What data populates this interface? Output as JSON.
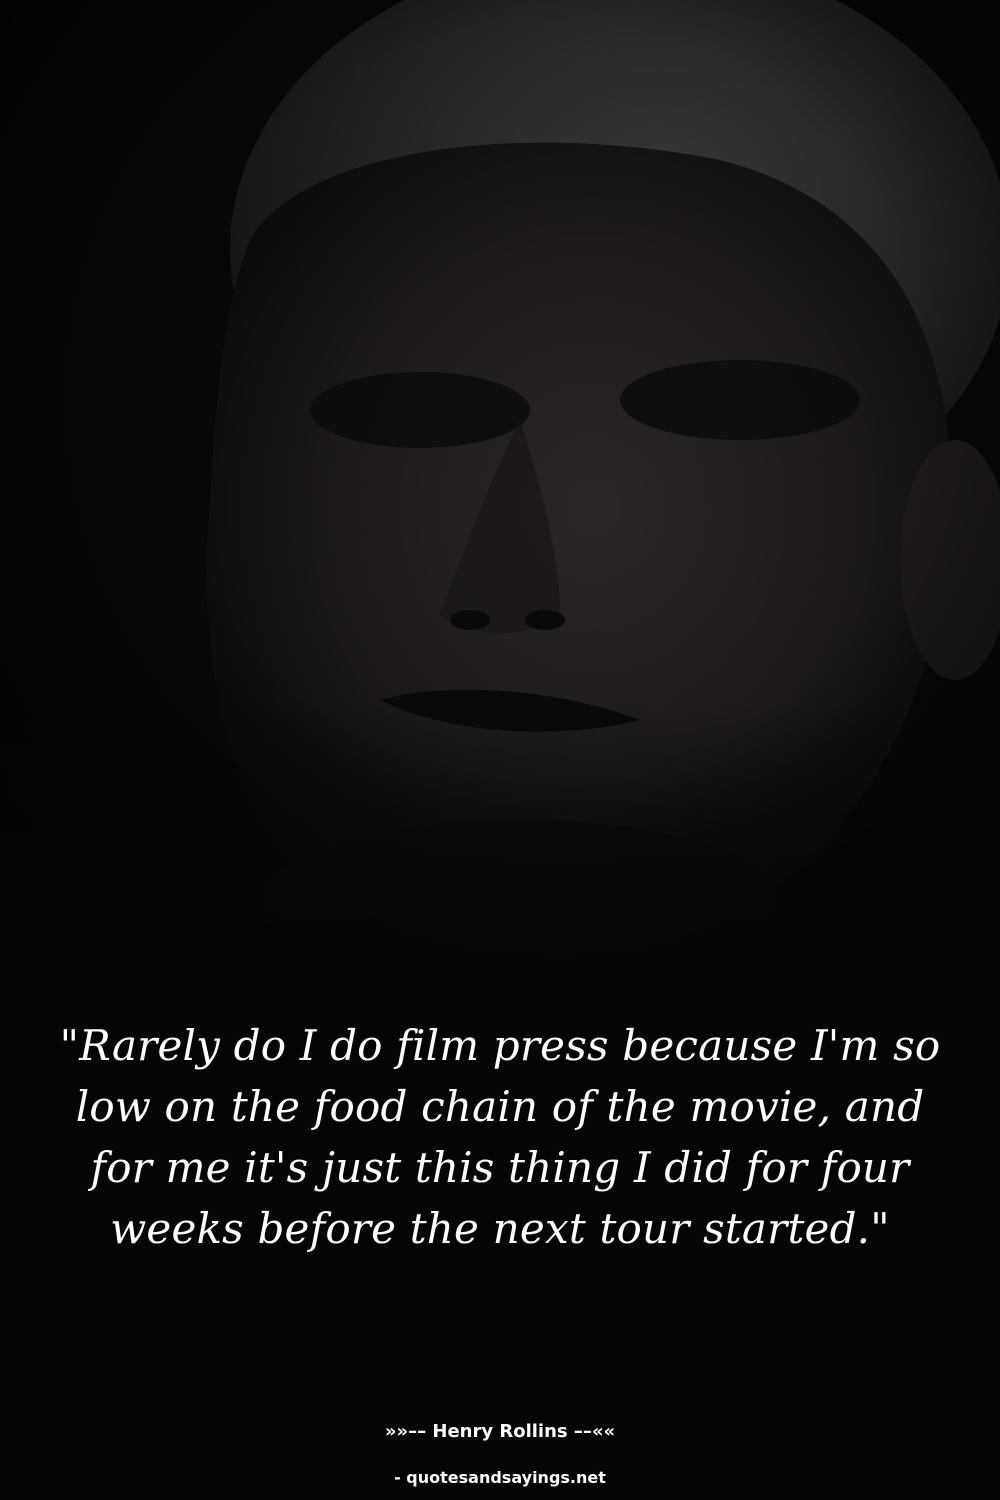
{
  "quote": {
    "text": "\"Rarely do I do film press because I'm so low on the food chain of the movie, and for me it's just this thing I did for four weeks before the next tour started.\""
  },
  "author": {
    "line": "»»–– Henry Rollins ––««"
  },
  "source": {
    "text": "- quotesandsayings.net"
  },
  "colors": {
    "background": "#050505",
    "text": "#ffffff"
  }
}
